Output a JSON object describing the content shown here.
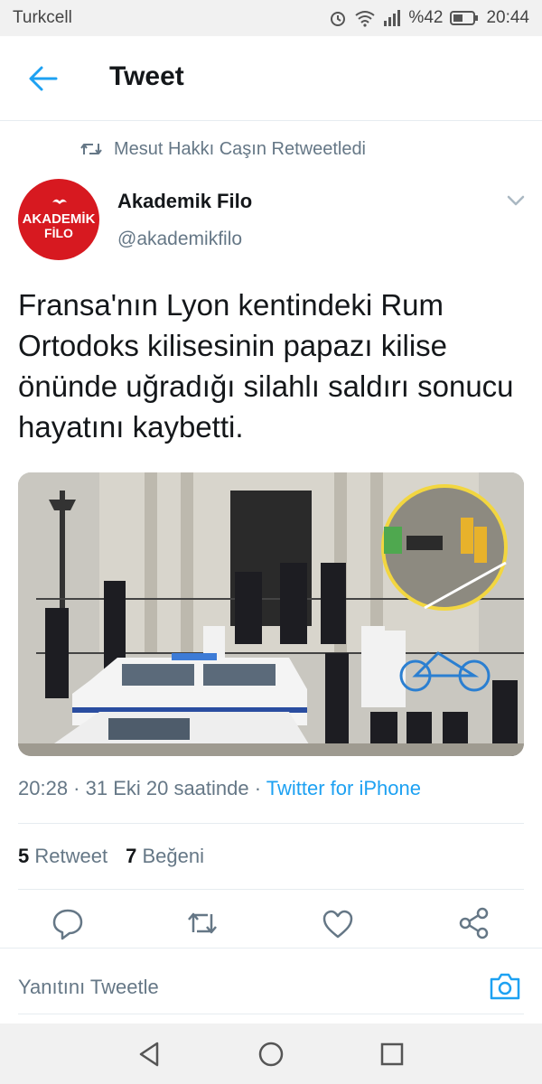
{
  "status_bar": {
    "carrier": "Turkcell",
    "battery": "%42",
    "time": "20:44",
    "icons": [
      "alarm-icon",
      "wifi-icon",
      "signal-icon",
      "battery-icon"
    ]
  },
  "header": {
    "title": "Tweet"
  },
  "retweet_context": {
    "text": "Mesut Hakkı Caşın Retweetledi"
  },
  "author": {
    "name": "Akademik Filo",
    "handle": "@akademikfilo",
    "avatar_line1": "AKADEMİK",
    "avatar_line2": "FİLO"
  },
  "tweet": {
    "text": "Fransa'nın Lyon kentindeki Rum Ortodoks kilisesinin papazı kilise önünde uğradığı silahlı saldırı sonucu hayatını kaybetti."
  },
  "meta": {
    "timestamp": "20:28 · 31 Eki 20 saatinde · ",
    "source": "Twitter for iPhone"
  },
  "counts": {
    "retweets_value": "5",
    "retweets_label": "Retweet",
    "likes_value": "7",
    "likes_label": "Beğeni"
  },
  "reply": {
    "placeholder": "Yanıtını Tweetle"
  },
  "colors": {
    "accent": "#1da1f2",
    "avatar_bg": "#d71920",
    "muted": "#657786"
  }
}
